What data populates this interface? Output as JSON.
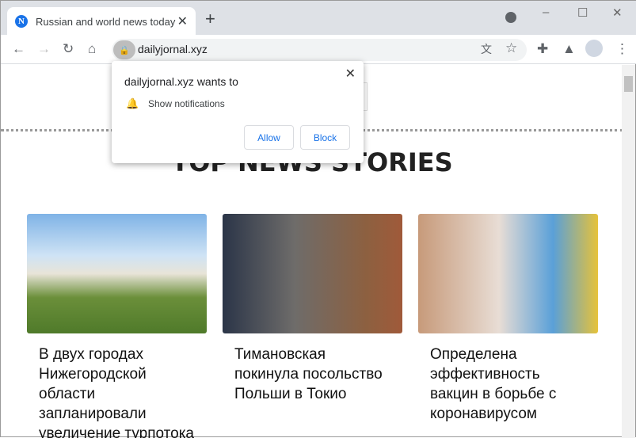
{
  "tab": {
    "title": "Russian and world news today",
    "favicon_letter": "N"
  },
  "address": {
    "url": "dailyjornal.xyz"
  },
  "page": {
    "heading": "TOP NEWS STORIES",
    "cards": [
      {
        "title": "В двух городах Нижегородской области запланировали увеличение турпотока"
      },
      {
        "title": "Тимановская покинула посольство Польши в Токио"
      },
      {
        "title": "Определена эффективность вакцин в борьбе с коронавирусом"
      }
    ]
  },
  "popup": {
    "title": "dailyjornal.xyz wants to",
    "permission": "Show notifications",
    "allow": "Allow",
    "block": "Block"
  }
}
